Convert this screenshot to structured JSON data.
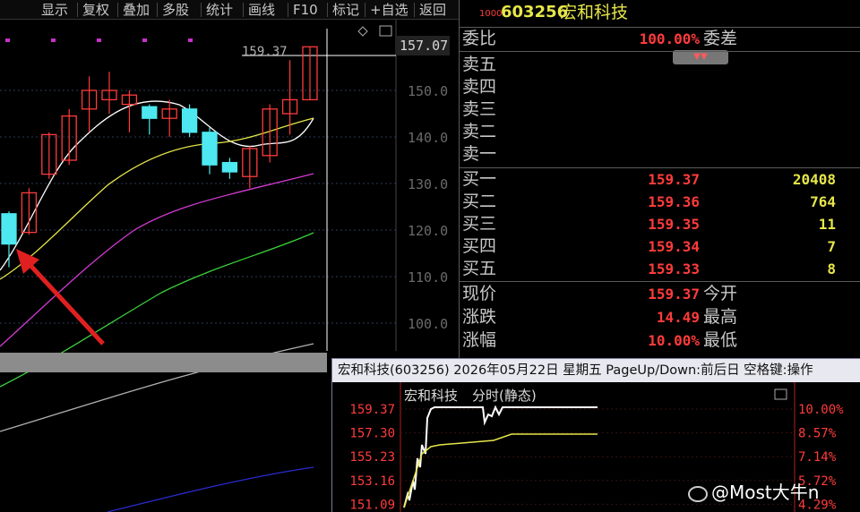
{
  "toolbar": {
    "items": [
      "显示",
      "复权",
      "叠加",
      "多股",
      "统计",
      "画线",
      "F10",
      "标记",
      "+自选",
      "返回"
    ]
  },
  "kline": {
    "price_labels": [
      "157.07",
      "150.0",
      "140.0",
      "130.0",
      "120.0",
      "110.0",
      "100.0"
    ],
    "high_label": "159.37",
    "colors": {
      "up": "#ff3b3b",
      "down": "#4de8f0",
      "ma5": "#ffffff",
      "ma10": "#e6e64a",
      "ma20": "#d23ad2",
      "ma60": "#3ad23a",
      "ma120": "#b0b0b0",
      "ma250": "#2a2ad2"
    }
  },
  "chart_data": {
    "type": "candlestick",
    "ylim": [
      95,
      163
    ],
    "candles": [
      {
        "o": 123.5,
        "c": 117.0,
        "h": 124.0,
        "l": 112.0
      },
      {
        "o": 119.5,
        "c": 128.0,
        "h": 129.0,
        "l": 119.0
      },
      {
        "o": 132.0,
        "c": 140.5,
        "h": 141.0,
        "l": 131.0
      },
      {
        "o": 135.0,
        "c": 144.5,
        "h": 146.0,
        "l": 134.0
      },
      {
        "o": 146.0,
        "c": 150.0,
        "h": 153.0,
        "l": 141.0
      },
      {
        "o": 148.0,
        "c": 150.0,
        "h": 154.0,
        "l": 145.0
      },
      {
        "o": 147.0,
        "c": 149.0,
        "h": 150.0,
        "l": 141.0
      },
      {
        "o": 146.5,
        "c": 144.0,
        "h": 147.0,
        "l": 140.5
      },
      {
        "o": 144.0,
        "c": 146.0,
        "h": 148.0,
        "l": 140.0
      },
      {
        "o": 146.0,
        "c": 141.0,
        "h": 147.0,
        "l": 140.0
      },
      {
        "o": 141.0,
        "c": 134.0,
        "h": 142.0,
        "l": 132.0
      },
      {
        "o": 134.5,
        "c": 132.5,
        "h": 135.5,
        "l": 131.0
      },
      {
        "o": 131.5,
        "c": 137.5,
        "h": 138.0,
        "l": 129.0
      },
      {
        "o": 136.0,
        "c": 146.0,
        "h": 147.0,
        "l": 134.5
      },
      {
        "o": 145.0,
        "c": 148.0,
        "h": 156.5,
        "l": 140.5
      },
      {
        "o": 148.0,
        "c": 159.37,
        "h": 159.37,
        "l": 148.0
      }
    ]
  },
  "quote": {
    "code": "603256",
    "name": "宏和科技",
    "small_mark": "1000",
    "weibi_label": "委比",
    "weibi_value": "100.00%",
    "weicha_label": "委差",
    "sell": [
      {
        "label": "卖五",
        "price": "",
        "vol": ""
      },
      {
        "label": "卖四",
        "price": "",
        "vol": ""
      },
      {
        "label": "卖三",
        "price": "",
        "vol": ""
      },
      {
        "label": "卖二",
        "price": "",
        "vol": ""
      },
      {
        "label": "卖一",
        "price": "",
        "vol": ""
      }
    ],
    "buy": [
      {
        "label": "买一",
        "price": "159.37",
        "vol": "20408"
      },
      {
        "label": "买二",
        "price": "159.36",
        "vol": "764"
      },
      {
        "label": "买三",
        "price": "159.35",
        "vol": "11"
      },
      {
        "label": "买四",
        "price": "159.34",
        "vol": "7"
      },
      {
        "label": "买五",
        "price": "159.33",
        "vol": "8"
      }
    ],
    "stats": [
      {
        "label": "现价",
        "value": "159.37",
        "label2": "今开"
      },
      {
        "label": "涨跌",
        "value": "14.49",
        "label2": "最高"
      },
      {
        "label": "涨幅",
        "value": "10.00%",
        "label2": "最低"
      }
    ]
  },
  "popup": {
    "title": "宏和科技(603256) 2026年05月22日 星期五 PageUp/Down:前后日 空格键:操作",
    "chart_title": "宏和科技",
    "chart_mode": "分时(静态)",
    "left_labels": [
      "159.37",
      "157.30",
      "155.23",
      "153.16",
      "151.09"
    ],
    "right_labels": [
      "10.00%",
      "8.57%",
      "7.14%",
      "5.72%",
      "4.29%"
    ]
  },
  "watermark": "@Most大牛n"
}
